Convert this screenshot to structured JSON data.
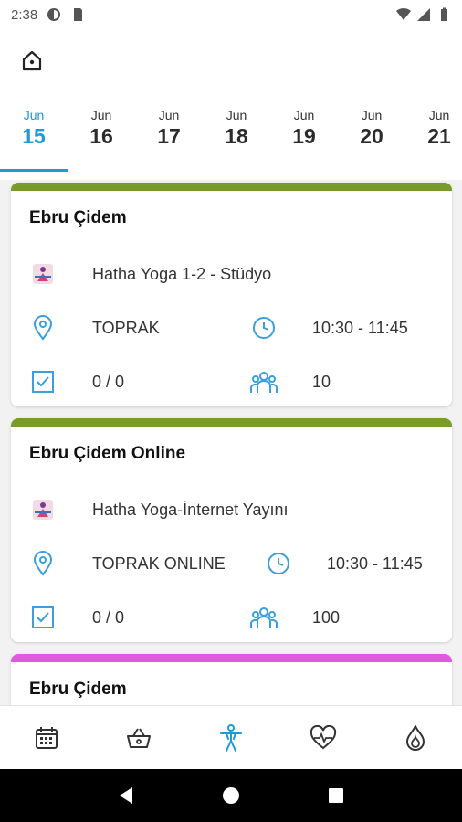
{
  "status": {
    "time": "2:38"
  },
  "dates": [
    {
      "month": "Jun",
      "day": "15",
      "active": true
    },
    {
      "month": "Jun",
      "day": "16"
    },
    {
      "month": "Jun",
      "day": "17"
    },
    {
      "month": "Jun",
      "day": "18"
    },
    {
      "month": "Jun",
      "day": "19"
    },
    {
      "month": "Jun",
      "day": "20"
    },
    {
      "month": "Jun",
      "day": "21"
    }
  ],
  "cards": [
    {
      "instructor": "Ebru Çidem",
      "class_name": "Hatha Yoga 1-2 - Stüdyo",
      "location": "TOPRAK",
      "time": "10:30 - 11:45",
      "booked": "0 / 0",
      "capacity": "10",
      "accent": "#7a9a2a"
    },
    {
      "instructor": "Ebru Çidem Online",
      "class_name": "Hatha Yoga-İnternet Yayını",
      "location": "TOPRAK ONLINE",
      "time": "10:30 - 11:45",
      "booked": "0 / 0",
      "capacity": "100",
      "accent": "#7a9a2a"
    },
    {
      "instructor": "Ebru Çidem",
      "accent": "#e05adf"
    }
  ],
  "colors": {
    "primary": "#1e9ad6",
    "icon_blue": "#3a9fdc"
  },
  "nav": [
    "calendar-icon",
    "basket-icon",
    "person-activity-icon",
    "heart-pulse-icon",
    "flame-icon"
  ]
}
